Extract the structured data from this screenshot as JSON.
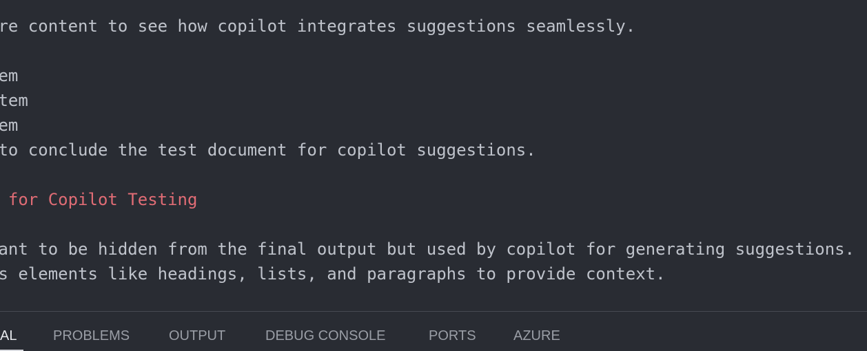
{
  "editor": {
    "lines": [
      {
        "text": "ore content to see how copilot integrates suggestions seamlessly.",
        "kind": "text"
      },
      {
        "text": "",
        "kind": "blank"
      },
      {
        "text": "tem",
        "kind": "text"
      },
      {
        "text": "item",
        "kind": "text"
      },
      {
        "text": "tem",
        "kind": "text"
      },
      {
        "text": " to conclude the test document for copilot suggestions.",
        "kind": "text"
      },
      {
        "text": "",
        "kind": "blank"
      },
      {
        "text": "t for Copilot Testing",
        "kind": "heading"
      },
      {
        "text": "",
        "kind": "blank"
      },
      {
        "text": "eant to be hidden from the final output but used by copilot for generating suggestions.",
        "kind": "text"
      },
      {
        "text": "us elements like headings, lists, and paragraphs to provide context.",
        "kind": "text"
      }
    ]
  },
  "panel": {
    "tabs": [
      {
        "label": "AL",
        "active": true
      },
      {
        "label": "PROBLEMS",
        "active": false
      },
      {
        "label": "OUTPUT",
        "active": false
      },
      {
        "label": "DEBUG CONSOLE",
        "active": false
      },
      {
        "label": "PORTS",
        "active": false
      },
      {
        "label": "AZURE",
        "active": false
      }
    ]
  },
  "colors": {
    "editor_background": "#292c33",
    "text": "#bfc3cb",
    "heading": "#e06c75",
    "tab_inactive": "#9a9ea6",
    "tab_active": "#e6e8ec"
  }
}
